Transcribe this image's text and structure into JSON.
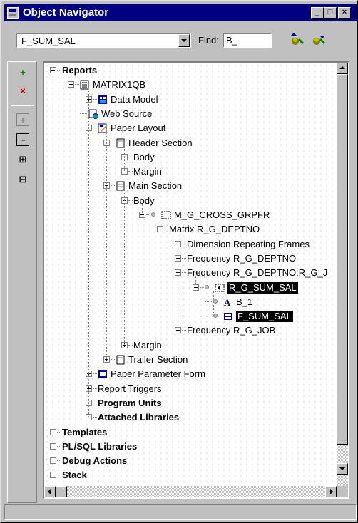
{
  "window": {
    "title": "Object Navigator",
    "controls": [
      "_",
      "□",
      "×"
    ]
  },
  "toolbar": {
    "combo_value": "F_SUM_SAL",
    "find_label": "Find:",
    "find_value": "B_"
  },
  "left_toolbar": [
    {
      "icon": "create-icon",
      "glyph": "+"
    },
    {
      "icon": "delete-icon",
      "glyph": "×"
    },
    {
      "icon": "expand-icon",
      "glyph": "+"
    },
    {
      "icon": "collapse-icon",
      "glyph": "−"
    },
    {
      "icon": "expand-all-icon",
      "glyph": "⊞"
    },
    {
      "icon": "collapse-all-icon",
      "glyph": "⊟"
    }
  ],
  "tree": [
    {
      "id": "reports",
      "label": "Reports",
      "level": 0,
      "exp": "minus",
      "bold": true
    },
    {
      "id": "matrix1qb",
      "label": "MATRIX1QB",
      "level": 1,
      "exp": "minus",
      "icon": "report-icon"
    },
    {
      "id": "data-model",
      "label": "Data Model",
      "level": 2,
      "exp": "plus",
      "icon": "data-model-icon"
    },
    {
      "id": "web-source",
      "label": "Web Source",
      "level": 2,
      "exp": "none",
      "icon": "web-source-icon"
    },
    {
      "id": "paper-layout",
      "label": "Paper Layout",
      "level": 2,
      "exp": "minus",
      "icon": "paper-layout-icon"
    },
    {
      "id": "header-section",
      "label": "Header Section",
      "level": 3,
      "exp": "minus",
      "icon": "section-icon"
    },
    {
      "id": "header-body",
      "label": "Body",
      "level": 4,
      "exp": "leaf"
    },
    {
      "id": "header-margin",
      "label": "Margin",
      "level": 4,
      "exp": "leaf"
    },
    {
      "id": "main-section",
      "label": "Main Section",
      "level": 3,
      "exp": "minus",
      "icon": "main-section-icon"
    },
    {
      "id": "main-body",
      "label": "Body",
      "level": 4,
      "exp": "minus"
    },
    {
      "id": "m-g-cross",
      "label": "M_G_CROSS_GRPFR",
      "level": 5,
      "exp": "minus",
      "icon": "frame-icon",
      "dot": true
    },
    {
      "id": "matrix-r-g-deptno",
      "label": "Matrix R_G_DEPTNO",
      "level": 6,
      "exp": "minus"
    },
    {
      "id": "dim-repeating",
      "label": "Dimension Repeating Frames",
      "level": 7,
      "exp": "plus"
    },
    {
      "id": "freq-r-g-deptno",
      "label": "Frequency R_G_DEPTNO",
      "level": 7,
      "exp": "plus"
    },
    {
      "id": "freq-r-g-deptno-r-g-j",
      "label": "Frequency R_G_DEPTNO:R_G_J",
      "level": 7,
      "exp": "minus"
    },
    {
      "id": "r-g-sum-sal",
      "label": "R_G_SUM_SAL",
      "level": 8,
      "exp": "minus",
      "icon": "repeating-frame-icon",
      "dot": true,
      "selected": true
    },
    {
      "id": "b-1",
      "label": "B_1",
      "level": 9,
      "exp": "none",
      "icon": "text-icon",
      "dot": true
    },
    {
      "id": "f-sum-sal",
      "label": "F_SUM_SAL",
      "level": 9,
      "exp": "none",
      "icon": "field-icon",
      "dot": true,
      "selected": true
    },
    {
      "id": "freq-r-g-job",
      "label": "Frequency R_G_JOB",
      "level": 7,
      "exp": "plus"
    },
    {
      "id": "main-margin",
      "label": "Margin",
      "level": 4,
      "exp": "plus"
    },
    {
      "id": "trailer-section",
      "label": "Trailer Section",
      "level": 3,
      "exp": "plus",
      "icon": "section-icon"
    },
    {
      "id": "paper-param-form",
      "label": "Paper Parameter Form",
      "level": 2,
      "exp": "plus",
      "icon": "param-form-icon"
    },
    {
      "id": "report-triggers",
      "label": "Report Triggers",
      "level": 2,
      "exp": "plus"
    },
    {
      "id": "program-units",
      "label": "Program Units",
      "level": 2,
      "exp": "leaf",
      "bold": true
    },
    {
      "id": "attached-libraries",
      "label": "Attached Libraries",
      "level": 2,
      "exp": "leaf",
      "bold": true
    },
    {
      "id": "templates",
      "label": "Templates",
      "level": 0,
      "exp": "leaf",
      "bold": true
    },
    {
      "id": "plsql-libraries",
      "label": "PL/SQL Libraries",
      "level": 0,
      "exp": "leaf",
      "bold": true
    },
    {
      "id": "debug-actions",
      "label": "Debug Actions",
      "level": 0,
      "exp": "leaf",
      "bold": true
    },
    {
      "id": "stack",
      "label": "Stack",
      "level": 0,
      "exp": "leaf",
      "bold": true
    }
  ]
}
